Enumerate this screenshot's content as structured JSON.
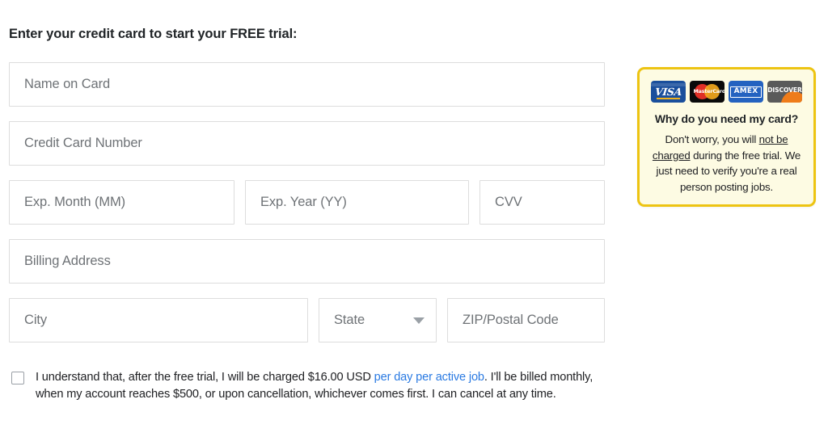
{
  "heading": "Enter your credit card to start your FREE trial:",
  "form": {
    "name_on_card": {
      "placeholder": "Name on Card"
    },
    "credit_card_number": {
      "placeholder": "Credit Card Number"
    },
    "exp_month": {
      "placeholder": "Exp. Month (MM)"
    },
    "exp_year": {
      "placeholder": "Exp. Year (YY)"
    },
    "cvv": {
      "placeholder": "CVV"
    },
    "billing_address": {
      "placeholder": "Billing Address"
    },
    "city": {
      "placeholder": "City"
    },
    "state": {
      "placeholder": "State",
      "caret_icon": "chevron-down-icon"
    },
    "zip": {
      "placeholder": "ZIP/Postal Code"
    }
  },
  "agreement": {
    "checked": false,
    "text_part1": "I understand that, after the free trial, I will be charged $16.00 USD ",
    "link_text": "per day per active job",
    "text_part2": ". I'll be billed monthly, when my account reaches $500, or upon cancellation, whichever comes first. I can cancel at any time.",
    "amount": "$16.00 USD",
    "threshold": "$500",
    "link_color": "#2a7ae2"
  },
  "info_box": {
    "title": "Why do you need my card?",
    "body_line1_a": "Don't worry, you will ",
    "body_line1_u": "not be",
    "body_line2_u": "charged",
    "body_line2_b": " during the free trial.",
    "body_line3": "We just need to verify you're",
    "body_line4": "a real person posting jobs.",
    "border_color": "#edc412",
    "background_color": "#fdfbe3",
    "cards": [
      {
        "name": "visa-card-logo",
        "label": "VISA"
      },
      {
        "name": "mastercard-card-logo",
        "label": "MasterCard"
      },
      {
        "name": "amex-card-logo",
        "label": "AMEX"
      },
      {
        "name": "discover-card-logo",
        "label": "DISCOVER"
      }
    ]
  }
}
